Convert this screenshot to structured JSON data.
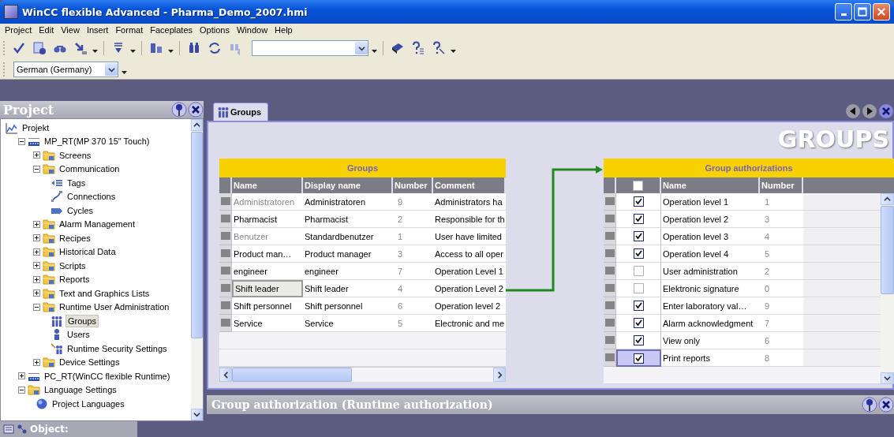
{
  "window": {
    "title": "WinCC flexible Advanced - Pharma_Demo_2007.hmi"
  },
  "menu": [
    "Project",
    "Edit",
    "View",
    "Insert",
    "Format",
    "Faceplates",
    "Options",
    "Window",
    "Help"
  ],
  "language_select": {
    "value": "German (Germany)"
  },
  "project_panel": {
    "title": "Project",
    "tree": [
      {
        "label": "Projekt",
        "kind": "root",
        "selected": false,
        "children": [
          {
            "label": "MP_RT(MP 370 15\" Touch)",
            "kind": "device",
            "expanded": true,
            "selected": false,
            "children": [
              {
                "label": "Screens",
                "kind": "folder",
                "expanded": false,
                "selected": false
              },
              {
                "label": "Communication",
                "kind": "folder",
                "expanded": true,
                "selected": false,
                "children": [
                  {
                    "label": "Tags",
                    "kind": "tags",
                    "selected": false
                  },
                  {
                    "label": "Connections",
                    "kind": "connections",
                    "selected": false
                  },
                  {
                    "label": "Cycles",
                    "kind": "cycles",
                    "selected": false
                  }
                ]
              },
              {
                "label": "Alarm Management",
                "kind": "folder",
                "expanded": false,
                "selected": false
              },
              {
                "label": "Recipes",
                "kind": "folder",
                "expanded": false,
                "selected": false
              },
              {
                "label": "Historical Data",
                "kind": "folder",
                "expanded": false,
                "selected": false
              },
              {
                "label": "Scripts",
                "kind": "folder",
                "expanded": false,
                "selected": false
              },
              {
                "label": "Reports",
                "kind": "folder",
                "expanded": false,
                "selected": false
              },
              {
                "label": "Text and Graphics Lists",
                "kind": "folder",
                "expanded": false,
                "selected": false
              },
              {
                "label": "Runtime User Administration",
                "kind": "folder",
                "expanded": true,
                "selected": false,
                "children": [
                  {
                    "label": "Groups",
                    "kind": "groups",
                    "selected": true
                  },
                  {
                    "label": "Users",
                    "kind": "users",
                    "selected": false
                  },
                  {
                    "label": "Runtime Security Settings",
                    "kind": "security",
                    "selected": false
                  }
                ]
              },
              {
                "label": "Device Settings",
                "kind": "folder",
                "expanded": false,
                "selected": false
              }
            ]
          },
          {
            "label": "PC_RT(WinCC flexible Runtime)",
            "kind": "device",
            "expanded": false,
            "selected": false
          },
          {
            "label": "Language Settings",
            "kind": "folder",
            "expanded": true,
            "selected": false,
            "children": [
              {
                "label": "Project Languages",
                "kind": "language",
                "selected": false
              }
            ]
          }
        ]
      }
    ]
  },
  "object_tab": {
    "label": "Object:"
  },
  "editor": {
    "tabs": [
      {
        "label": "Groups",
        "selected": true
      }
    ],
    "heading": "GROUPS",
    "groups_table": {
      "title": "Groups",
      "columns": [
        "Name",
        "Display name",
        "Number",
        "Comment"
      ],
      "rows": [
        {
          "name": "Administratoren",
          "display_name": "Administratoren",
          "number": "9",
          "comment": "Administrators ha",
          "dimmed": true,
          "selected": false
        },
        {
          "name": "Pharmacist",
          "display_name": "Pharmacist",
          "number": "2",
          "comment": "Responsible for th",
          "dimmed": false,
          "selected": false
        },
        {
          "name": "Benutzer",
          "display_name": "Standardbenutzer",
          "number": "1",
          "comment": "User have limited",
          "dimmed": true,
          "selected": false
        },
        {
          "name": "Product man…",
          "display_name": "Product manager",
          "number": "3",
          "comment": "Access to all oper",
          "dimmed": false,
          "selected": false
        },
        {
          "name": "engineer",
          "display_name": "engineer",
          "number": "7",
          "comment": "Operation Level 1",
          "dimmed": false,
          "selected": false
        },
        {
          "name": "Shift leader",
          "display_name": "Shift leader",
          "number": "4",
          "comment": "Operation Level 2",
          "dimmed": false,
          "selected": true
        },
        {
          "name": "Shift personnel",
          "display_name": "Shift personnel",
          "number": "6",
          "comment": "Operation level 2",
          "dimmed": false,
          "selected": false
        },
        {
          "name": "Service",
          "display_name": "Service",
          "number": "5",
          "comment": "Electronic and me",
          "dimmed": false,
          "selected": false
        }
      ]
    },
    "authorizations_table": {
      "title": "Group authorizations",
      "header_checkbox": {
        "checked": false
      },
      "columns": [
        "Name",
        "Number"
      ],
      "rows": [
        {
          "checked": true,
          "name": "Operation level 1",
          "number": "1",
          "selected": false
        },
        {
          "checked": true,
          "name": "Operation level 2",
          "number": "3",
          "selected": false
        },
        {
          "checked": true,
          "name": "Operation level 3",
          "number": "4",
          "selected": false
        },
        {
          "checked": true,
          "name": "Operation level 4",
          "number": "5",
          "selected": false
        },
        {
          "checked": false,
          "name": "User administration",
          "number": "2",
          "selected": false
        },
        {
          "checked": false,
          "name": "Elektronic signature",
          "number": "0",
          "selected": false
        },
        {
          "checked": true,
          "name": "Enter laboratory val…",
          "number": "9",
          "selected": false
        },
        {
          "checked": true,
          "name": "Alarm acknowledgment",
          "number": "7",
          "selected": false
        },
        {
          "checked": true,
          "name": "View only",
          "number": "6",
          "selected": false
        },
        {
          "checked": true,
          "name": "Print reports",
          "number": "8",
          "selected": true
        }
      ]
    }
  },
  "properties_panel": {
    "title": "Group authorization (Runtime authorization)"
  }
}
